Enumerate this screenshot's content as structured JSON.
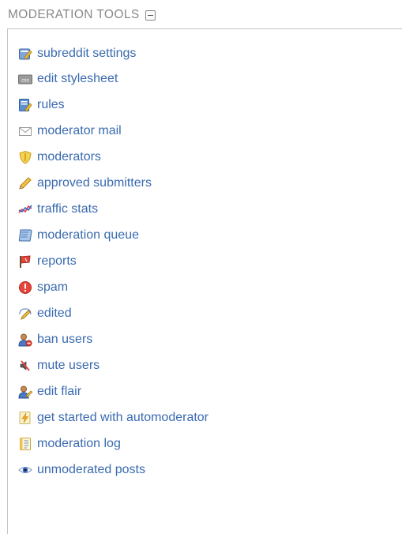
{
  "header": {
    "title": "MODERATION TOOLS"
  },
  "tools": [
    {
      "label": "subreddit settings",
      "icon": "settings-pencil-icon"
    },
    {
      "label": "edit stylesheet",
      "icon": "css-icon"
    },
    {
      "label": "rules",
      "icon": "rules-icon"
    },
    {
      "label": "moderator mail",
      "icon": "envelope-icon"
    },
    {
      "label": "moderators",
      "icon": "shield-icon"
    },
    {
      "label": "approved submitters",
      "icon": "pencil-icon"
    },
    {
      "label": "traffic stats",
      "icon": "chart-line-icon"
    },
    {
      "label": "moderation queue",
      "icon": "scroll-icon"
    },
    {
      "label": "reports",
      "icon": "flag-icon"
    },
    {
      "label": "spam",
      "icon": "alert-icon"
    },
    {
      "label": "edited",
      "icon": "edit-pencil-icon"
    },
    {
      "label": "ban users",
      "icon": "ban-user-icon"
    },
    {
      "label": "mute users",
      "icon": "mute-icon"
    },
    {
      "label": "edit flair",
      "icon": "flair-user-icon"
    },
    {
      "label": "get started with automoderator",
      "icon": "automod-icon"
    },
    {
      "label": "moderation log",
      "icon": "log-icon"
    },
    {
      "label": "unmoderated posts",
      "icon": "eye-icon"
    }
  ]
}
